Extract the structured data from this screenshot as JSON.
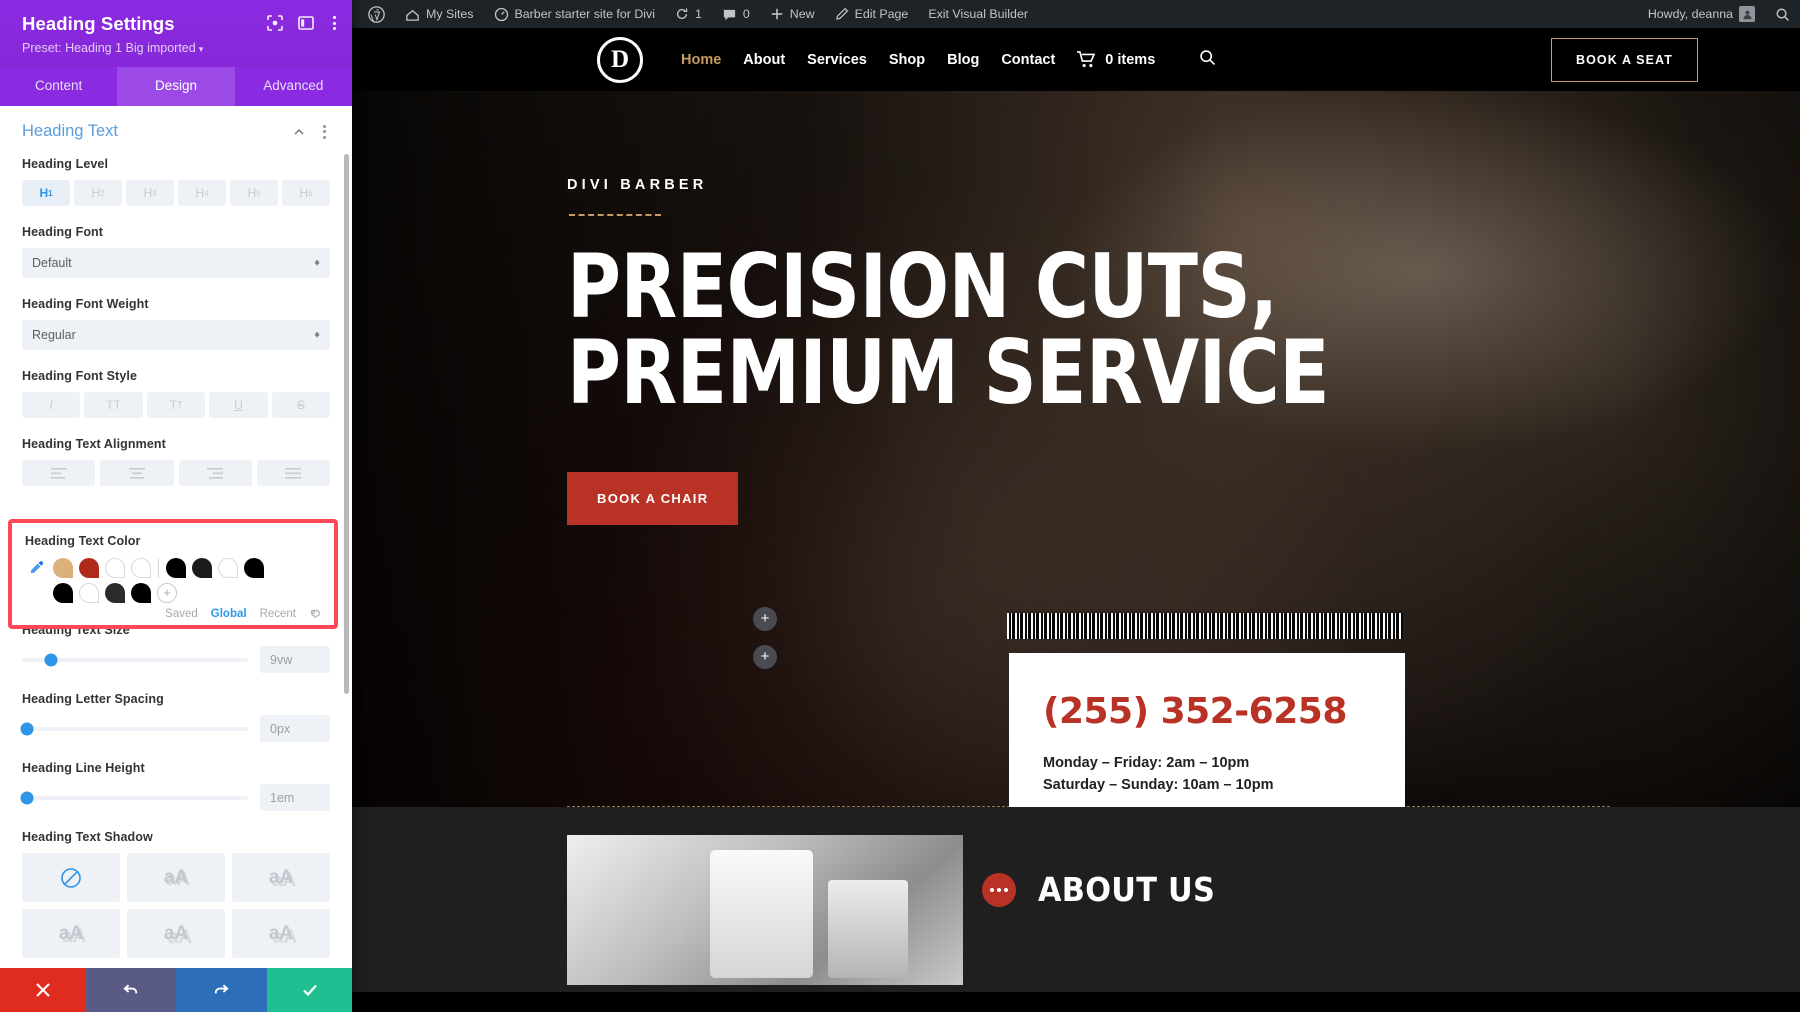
{
  "panel": {
    "title": "Heading Settings",
    "preset": "Preset: Heading 1 Big imported",
    "tabs": [
      {
        "label": "Content",
        "active": false
      },
      {
        "label": "Design",
        "active": true
      },
      {
        "label": "Advanced",
        "active": false
      }
    ],
    "section_title": "Heading Text",
    "fields": {
      "heading_level": {
        "label": "Heading Level",
        "options": [
          "H1",
          "H2",
          "H3",
          "H4",
          "H5",
          "H6"
        ],
        "selected": "H1"
      },
      "heading_font": {
        "label": "Heading Font",
        "value": "Default"
      },
      "heading_font_weight": {
        "label": "Heading Font Weight",
        "value": "Regular"
      },
      "heading_font_style": {
        "label": "Heading Font Style",
        "options": [
          "I",
          "TT",
          "Tt",
          "U",
          "S"
        ]
      },
      "heading_text_alignment": {
        "label": "Heading Text Alignment"
      },
      "heading_text_color": {
        "label": "Heading Text Color",
        "swatches_row1": [
          "#dbb07a",
          "#b02a1c",
          "#ffffff",
          "#ffffff",
          "#000000",
          "#1a1a1a",
          "#ffffff",
          "#000000"
        ],
        "swatches_row2": [
          "#000000",
          "#ffffff",
          "#2b2b2b",
          "#000000"
        ],
        "add_label": "+",
        "palette_tabs": [
          {
            "label": "Saved",
            "active": false
          },
          {
            "label": "Global",
            "active": true
          },
          {
            "label": "Recent",
            "active": false
          }
        ]
      },
      "heading_text_size": {
        "label": "Heading Text Size",
        "value": "9vw",
        "knob_pct": 13
      },
      "heading_letter_spacing": {
        "label": "Heading Letter Spacing",
        "value": "0px",
        "knob_pct": 2
      },
      "heading_line_height": {
        "label": "Heading Line Height",
        "value": "1em",
        "knob_pct": 2
      },
      "heading_text_shadow": {
        "label": "Heading Text Shadow",
        "tiles": [
          "",
          "aA",
          "aA",
          "aA",
          "aA",
          "aA"
        ]
      }
    },
    "footer": {
      "cancel": "cancel-icon",
      "undo": "undo-icon",
      "redo": "redo-icon",
      "save": "check-icon"
    }
  },
  "adminbar": {
    "left_items": [
      {
        "label": "",
        "icon": "wordpress-logo-icon"
      },
      {
        "label": "My Sites",
        "icon": "sites-icon"
      },
      {
        "label": "Barber starter site for Divi",
        "icon": "dashboard-icon"
      },
      {
        "label": "1",
        "icon": "updates-icon"
      },
      {
        "label": "0",
        "icon": "comments-icon"
      },
      {
        "label": "New",
        "icon": "plus-icon"
      },
      {
        "label": "Edit Page",
        "icon": "pencil-icon"
      },
      {
        "label": "Exit Visual Builder",
        "icon": ""
      }
    ],
    "howdy": "Howdy, deanna",
    "search_icon": "search-icon"
  },
  "site": {
    "logo_letter": "D",
    "nav": [
      {
        "label": "Home",
        "active": true
      },
      {
        "label": "About",
        "active": false
      },
      {
        "label": "Services",
        "active": false
      },
      {
        "label": "Shop",
        "active": false
      },
      {
        "label": "Blog",
        "active": false
      },
      {
        "label": "Contact",
        "active": false
      }
    ],
    "cart_label": "0 items",
    "book_seat": "BOOK A SEAT",
    "hero": {
      "eyebrow": "DIVI BARBER",
      "heading": "PRECISION CUTS, PREMIUM SERVICE",
      "cta": "BOOK A CHAIR",
      "phone": "(255) 352-6258",
      "hours_line1": "Monday – Friday: 2am – 10pm",
      "hours_line2": "Saturday – Sunday: 10am – 10pm"
    },
    "about": {
      "title": "ABOUT US"
    }
  },
  "colors": {
    "panel_purple": "#8a2be2",
    "accent_blue": "#2d96e8",
    "highlight_red": "#ff4757",
    "brand_red": "#b93226",
    "brand_gold": "#c79a62"
  }
}
